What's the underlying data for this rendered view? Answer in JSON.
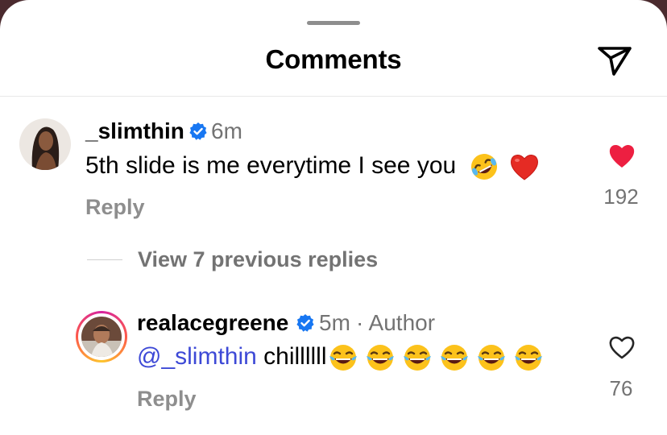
{
  "sheet": {
    "title": "Comments"
  },
  "comments": [
    {
      "username": "_slimthin",
      "verified": true,
      "time": "6m",
      "text": "5th slide is me everytime I see you",
      "reply_label": "Reply",
      "liked": true,
      "likes": "192"
    }
  ],
  "replies_toggle": "View 7 previous replies",
  "reply": {
    "username": "realacegreene",
    "verified": true,
    "time": "5m",
    "author_label": "· Author",
    "mention": "@_slimthin",
    "text": " chillllll",
    "reply_label": "Reply",
    "liked": false,
    "likes": "76"
  },
  "colors": {
    "heart_filled": "#ed1f41",
    "verified_blue": "#1877f2",
    "mention": "#3d49d6"
  },
  "icons": [
    "send-icon",
    "verified-icon",
    "heart-filled-icon",
    "heart-outline-icon",
    "rofl-emoji",
    "red-heart-emoji",
    "tears-of-joy-emoji"
  ]
}
